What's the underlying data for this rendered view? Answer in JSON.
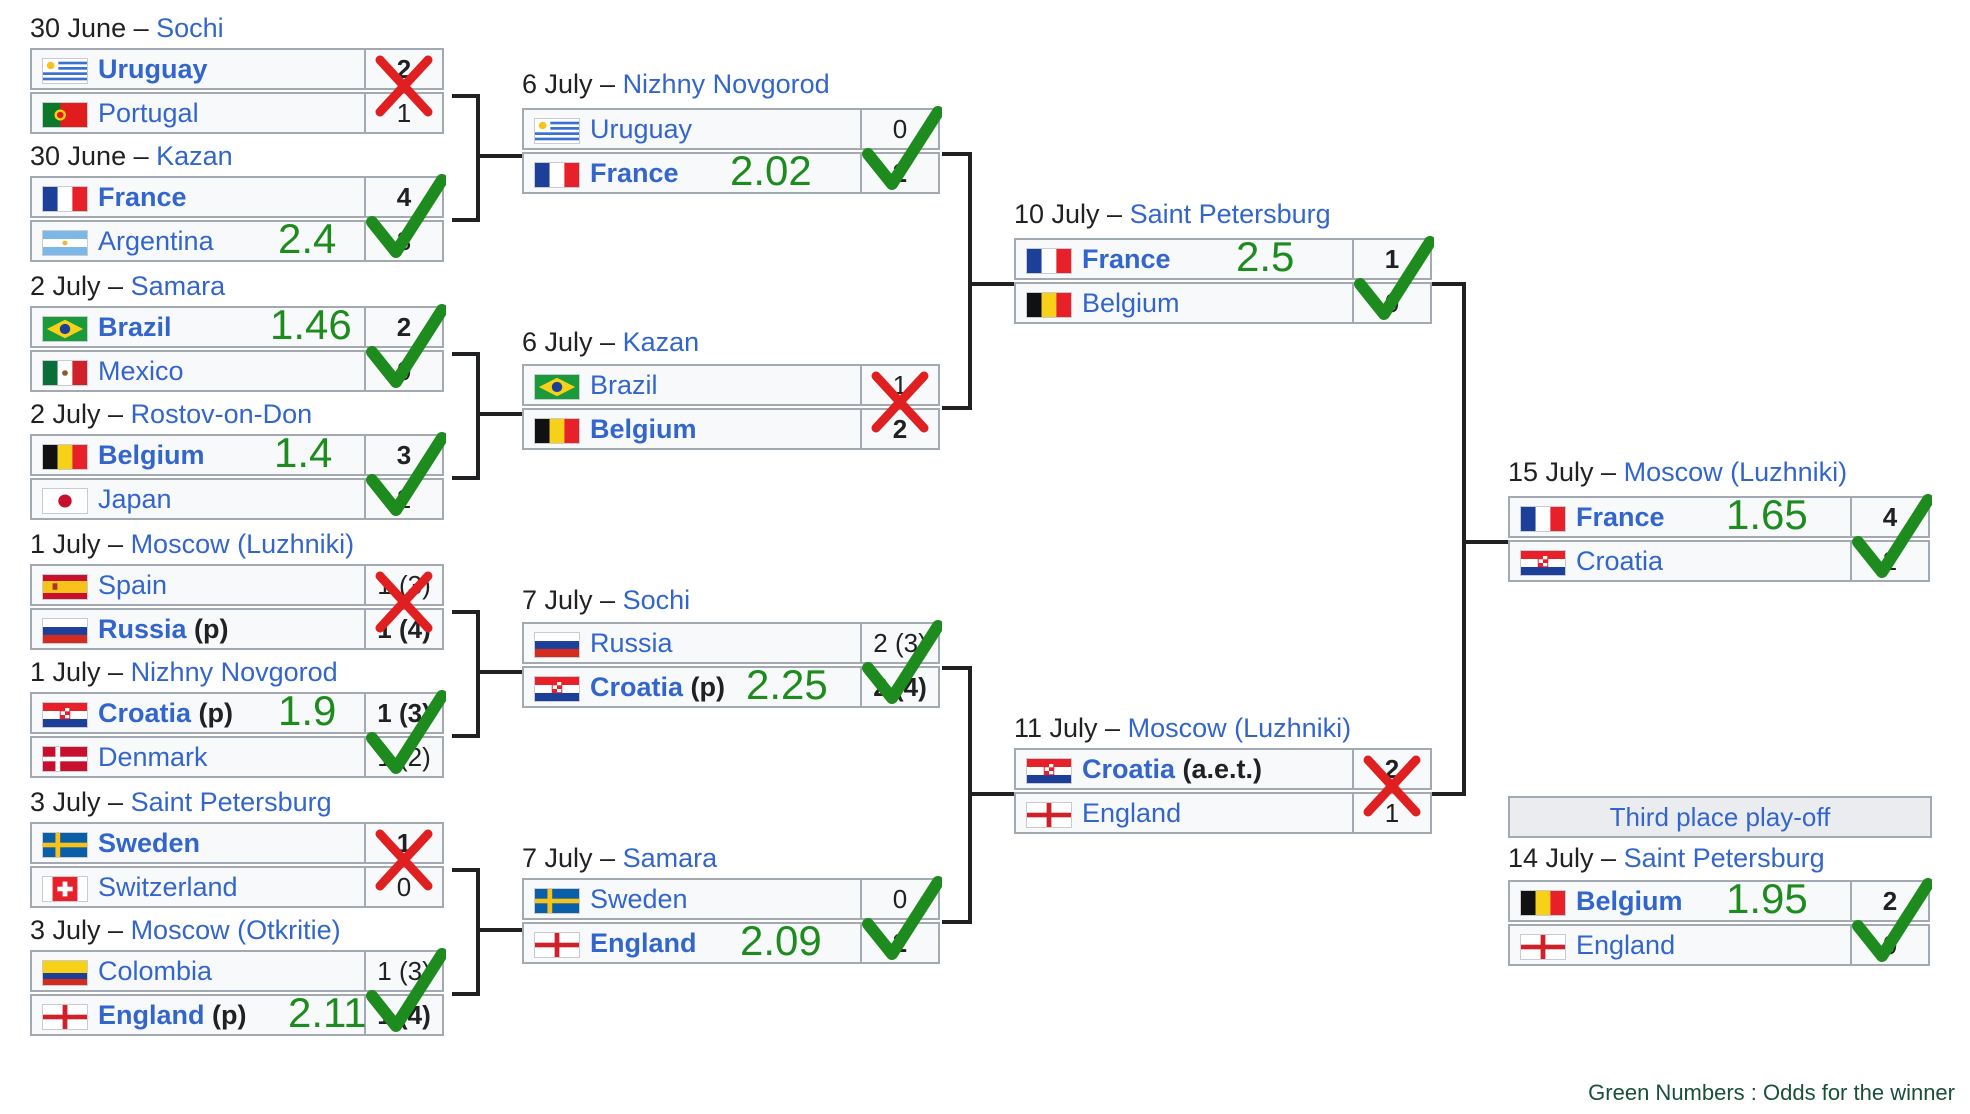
{
  "dates": {
    "r16_1": {
      "date": "30 June – ",
      "city": "Sochi"
    },
    "r16_2": {
      "date": "30 June – ",
      "city": "Kazan"
    },
    "r16_3": {
      "date": "2 July – ",
      "city": "Samara"
    },
    "r16_4": {
      "date": "2 July – ",
      "city": "Rostov-on-Don"
    },
    "r16_5": {
      "date": "1 July – ",
      "city": "Moscow (Luzhniki)"
    },
    "r16_6": {
      "date": "1 July – ",
      "city": "Nizhny Novgorod"
    },
    "r16_7": {
      "date": "3 July – ",
      "city": "Saint Petersburg"
    },
    "r16_8": {
      "date": "3 July – ",
      "city": "Moscow (Otkritie)"
    },
    "qf_1": {
      "date": "6 July – ",
      "city": "Nizhny Novgorod"
    },
    "qf_2": {
      "date": "6 July – ",
      "city": "Kazan"
    },
    "qf_3": {
      "date": "7 July – ",
      "city": "Sochi"
    },
    "qf_4": {
      "date": "7 July – ",
      "city": "Samara"
    },
    "sf_1": {
      "date": "10 July – ",
      "city": "Saint Petersburg"
    },
    "sf_2": {
      "date": "11 July – ",
      "city": "Moscow (Luzhniki)"
    },
    "final": {
      "date": "15 July – ",
      "city": "Moscow (Luzhniki)"
    },
    "third": {
      "date": "14 July – ",
      "city": "Saint Petersburg"
    }
  },
  "teams": {
    "r16_1_a": {
      "name": "Uruguay",
      "pen": "",
      "score": "2"
    },
    "r16_1_b": {
      "name": "Portugal",
      "pen": "",
      "score": "1"
    },
    "r16_2_a": {
      "name": "France",
      "pen": "",
      "score": "4"
    },
    "r16_2_b": {
      "name": "Argentina",
      "pen": "",
      "score": "3"
    },
    "r16_3_a": {
      "name": "Brazil",
      "pen": "",
      "score": "2"
    },
    "r16_3_b": {
      "name": "Mexico",
      "pen": "",
      "score": "0"
    },
    "r16_4_a": {
      "name": "Belgium",
      "pen": "",
      "score": "3"
    },
    "r16_4_b": {
      "name": "Japan",
      "pen": "",
      "score": "2"
    },
    "r16_5_a": {
      "name": "Spain",
      "pen": "",
      "score": "1 (3)"
    },
    "r16_5_b": {
      "name": "Russia",
      "pen": " (p)",
      "score": "1 (4)"
    },
    "r16_6_a": {
      "name": "Croatia",
      "pen": " (p)",
      "score": "1 (3)"
    },
    "r16_6_b": {
      "name": "Denmark",
      "pen": "",
      "score": "1 (2)"
    },
    "r16_7_a": {
      "name": "Sweden",
      "pen": "",
      "score": "1"
    },
    "r16_7_b": {
      "name": "Switzerland",
      "pen": "",
      "score": "0"
    },
    "r16_8_a": {
      "name": "Colombia",
      "pen": "",
      "score": "1 (3)"
    },
    "r16_8_b": {
      "name": "England",
      "pen": " (p)",
      "score": "1 (4)"
    },
    "qf_1_a": {
      "name": "Uruguay",
      "pen": "",
      "score": "0"
    },
    "qf_1_b": {
      "name": "France",
      "pen": "",
      "score": "2"
    },
    "qf_2_a": {
      "name": "Brazil",
      "pen": "",
      "score": "1"
    },
    "qf_2_b": {
      "name": "Belgium",
      "pen": "",
      "score": "2"
    },
    "qf_3_a": {
      "name": "Russia",
      "pen": "",
      "score": "2 (3)"
    },
    "qf_3_b": {
      "name": "Croatia",
      "pen": " (p)",
      "score": "2 (4)"
    },
    "qf_4_a": {
      "name": "Sweden",
      "pen": "",
      "score": "0"
    },
    "qf_4_b": {
      "name": "England",
      "pen": "",
      "score": "2"
    },
    "sf_1_a": {
      "name": "France",
      "pen": "",
      "score": "1"
    },
    "sf_1_b": {
      "name": "Belgium",
      "pen": "",
      "score": "0"
    },
    "sf_2_a": {
      "name": "Croatia",
      "pen": " (a.e.t.)",
      "score": "2"
    },
    "sf_2_b": {
      "name": "England",
      "pen": "",
      "score": "1"
    },
    "final_a": {
      "name": "France",
      "pen": "",
      "score": "4"
    },
    "final_b": {
      "name": "Croatia",
      "pen": "",
      "score": "2"
    },
    "third_a": {
      "name": "Belgium",
      "pen": "",
      "score": "2"
    },
    "third_b": {
      "name": "England",
      "pen": "",
      "score": "0"
    }
  },
  "odds": {
    "r16_2": "2.4",
    "r16_3": "1.46",
    "r16_4": "1.4",
    "r16_6": "1.9",
    "r16_8": "2.11",
    "qf_1": "2.02",
    "qf_3": "2.25",
    "qf_4": "2.09",
    "sf_1": "2.5",
    "final": "1.65",
    "third": "1.95"
  },
  "third_place_header": "Third place play-off",
  "footnote": "Green Numbers : Odds for the winner",
  "colors": {
    "check": "#1e8b1e",
    "cross": "#e02020",
    "link": "#3366cc",
    "odds": "#1e8b1e"
  }
}
